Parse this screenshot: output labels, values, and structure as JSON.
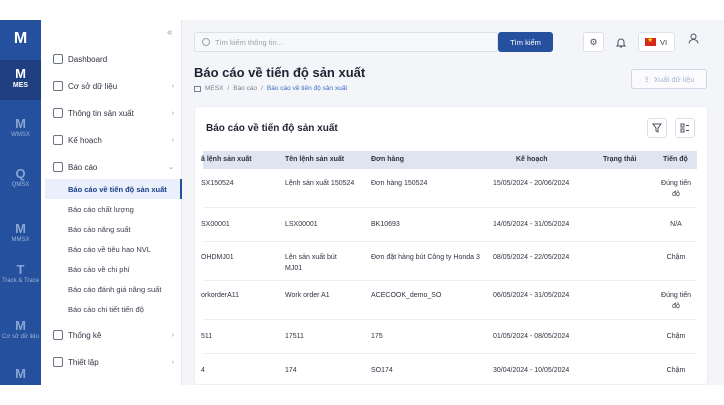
{
  "rail": {
    "logo": "M",
    "items": [
      {
        "glyph": "M",
        "label": "MES"
      },
      {
        "glyph": "M",
        "label": "WMSX"
      },
      {
        "glyph": "Q",
        "label": "QMSX"
      },
      {
        "glyph": "M",
        "label": "MMSX"
      },
      {
        "glyph": "T",
        "label": "Track & Trace"
      },
      {
        "glyph": "M",
        "label": "Cơ sở dữ liệu"
      },
      {
        "glyph": "M",
        "label": ""
      }
    ]
  },
  "sidebar": {
    "collapse_icon": "«",
    "items": [
      {
        "label": "Dashboard",
        "has_chevron": false
      },
      {
        "label": "Cơ sở dữ liệu",
        "has_chevron": true,
        "chevron": "›"
      },
      {
        "label": "Thông tin sản xuất",
        "has_chevron": true,
        "chevron": "›"
      },
      {
        "label": "Kế hoạch",
        "has_chevron": true,
        "chevron": "›"
      },
      {
        "label": "Báo cáo",
        "has_chevron": true,
        "chevron": "⌄"
      }
    ],
    "subitems": [
      {
        "label": "Báo cáo về tiến độ sản xuất",
        "active": true
      },
      {
        "label": "Báo cáo chất lượng",
        "active": false
      },
      {
        "label": "Báo cáo năng suất",
        "active": false
      },
      {
        "label": "Báo cáo về tiêu hao NVL",
        "active": false
      },
      {
        "label": "Báo cáo về chi phí",
        "active": false
      },
      {
        "label": "Báo cáo đánh giá năng suất",
        "active": false
      },
      {
        "label": "Báo cáo chi tiết tiến độ",
        "active": false
      }
    ],
    "bottom_items": [
      {
        "label": "Thống kê",
        "chevron": "›"
      },
      {
        "label": "Thiết lập",
        "chevron": "›"
      }
    ]
  },
  "topbar": {
    "search_placeholder": "Tìm kiếm thông tin...",
    "search_button": "Tìm kiếm",
    "language": "VI",
    "icons": [
      "gear-icon",
      "bell-icon",
      "user-icon"
    ]
  },
  "page": {
    "title": "Báo cáo về tiến độ sản xuất",
    "breadcrumb": [
      "MESX",
      "Báo cáo",
      "Báo cáo về tiến độ sản xuất"
    ],
    "export_button": "Xuất dữ liệu"
  },
  "card": {
    "title": "Báo cáo về tiến độ sản xuất",
    "icons": [
      "filter-icon",
      "columns-settings-icon"
    ]
  },
  "table": {
    "columns": [
      "ã lệnh sản xuất",
      "Tên lệnh sản xuất",
      "Đơn hàng",
      "Kế hoạch",
      "Trạng thái",
      "Tiến độ"
    ],
    "rows": [
      {
        "code": "SX150524",
        "name": "Lệnh sản xuất 150524",
        "order": "Đơn hàng 150524",
        "plan": "15/05/2024 - 20/06/2024",
        "status": "",
        "progress": "Đúng tiến độ"
      },
      {
        "code": "SX00001",
        "name": "LSX00001",
        "order": "BK10693",
        "plan": "14/05/2024 - 31/05/2024",
        "status": "",
        "progress": "N/A"
      },
      {
        "code": "OHDMJ01",
        "name": "Lện sản xuất bút MJ01",
        "order": "Đơn đặt hàng bút Công ty Honda 3",
        "plan": "08/05/2024 - 22/05/2024",
        "status": "",
        "progress": "Chậm"
      },
      {
        "code": "orkorderA11",
        "name": "Work order A1",
        "order": "ACECOOK_demo_SO",
        "plan": "06/05/2024 - 31/05/2024",
        "status": "",
        "progress": "Đúng tiến độ"
      },
      {
        "code": "511",
        "name": "17511",
        "order": "175",
        "plan": "01/05/2024 - 08/05/2024",
        "status": "",
        "progress": "Chậm"
      },
      {
        "code": "4",
        "name": "174",
        "order": "SO174",
        "plan": "30/04/2024 - 10/05/2024",
        "status": "",
        "progress": "Chậm"
      }
    ]
  }
}
